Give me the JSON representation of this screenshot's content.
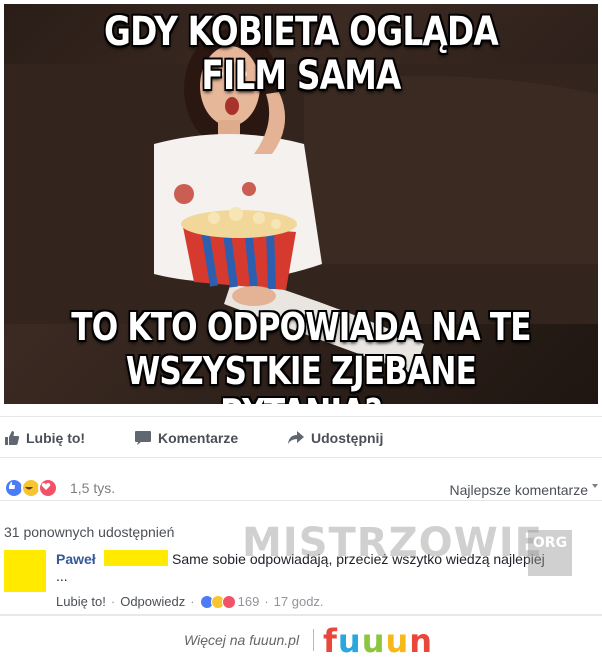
{
  "meme": {
    "caption_top": "GDY KOBIETA OGLĄDA FILM SAMA",
    "caption_bottom_line1": "TO KTO ODPOWIADA NA TE",
    "caption_bottom_line2": "WSZYSTKIE ZJEBANE PYTANIA?"
  },
  "actions": {
    "like": "Lubię to!",
    "comment": "Komentarze",
    "share": "Udostępnij"
  },
  "reactions": {
    "icons": [
      "like-reaction",
      "haha-reaction",
      "love-reaction"
    ],
    "count": "1,5 tys.",
    "sort_label": "Najlepsze komentarze"
  },
  "shares": "31 ponownych udostępnień",
  "comment": {
    "author": "Paweł",
    "text": "Same sobie odpowiadają, przecież wszytko wiedzą najlepiej",
    "text_continuation": "...",
    "like_link": "Lubię to!",
    "reply_link": "Odpowiedz",
    "separator": "·",
    "reaction_count": "169",
    "time": "17 godz."
  },
  "watermark": {
    "text": "MISTRZOWIE",
    "suffix": "ORG"
  },
  "footer": {
    "text": "Więcej na fuuun.pl",
    "logo_letters": [
      "f",
      "u",
      "u",
      "u",
      "n"
    ],
    "logo_colors": [
      "#e9473c",
      "#2aa7dc",
      "#8cc63f",
      "#f6b919",
      "#e9473c"
    ]
  },
  "colors": {
    "link_blue": "#365899",
    "redaction_yellow": "#ffea00",
    "like_blue": "#4b7cf5",
    "love_red": "#f25268",
    "haha_yellow": "#f7c531"
  }
}
